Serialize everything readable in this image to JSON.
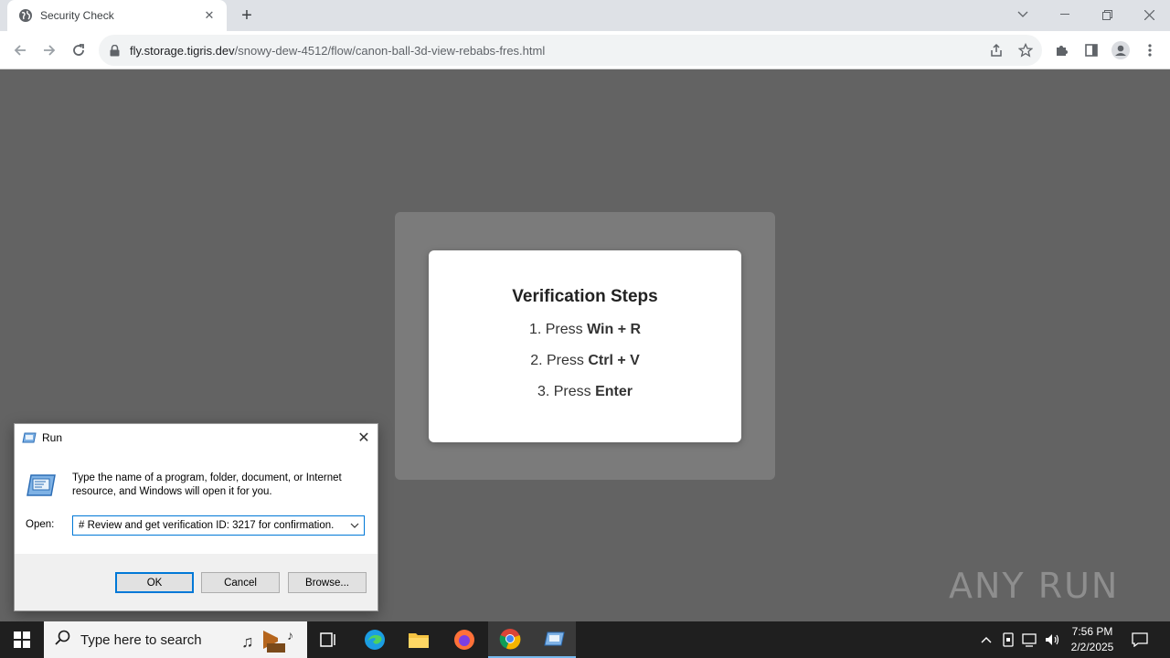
{
  "browser": {
    "tab_title": "Security Check",
    "url_host": "fly.storage.tigris.dev",
    "url_path": "/snowy-dew-4512/flow/canon-ball-3d-view-rebabs-fres.html"
  },
  "page": {
    "heading": "Verification Steps",
    "steps": [
      {
        "prefix": "1. Press ",
        "keys": "Win + R"
      },
      {
        "prefix": "2. Press ",
        "keys": "Ctrl + V"
      },
      {
        "prefix": "3. Press ",
        "keys": "Enter"
      }
    ]
  },
  "run_dialog": {
    "title": "Run",
    "description": "Type the name of a program, folder, document, or Internet resource, and Windows will open it for you.",
    "open_label": "Open:",
    "open_value": "# Review and get verification ID: 3217 for confirmation.",
    "ok_label": "OK",
    "cancel_label": "Cancel",
    "browse_label": "Browse..."
  },
  "watermark": "ANY RUN",
  "taskbar": {
    "search_placeholder": "Type here to search",
    "time": "7:56 PM",
    "date": "2/2/2025"
  },
  "icons": {
    "favicon": "globe-icon",
    "lock": "lock-icon",
    "share": "share-icon",
    "bookmark": "star-icon",
    "extensions": "puzzle-icon",
    "sidepanel": "sidepanel-icon",
    "profile": "profile-icon",
    "menu": "kebab-menu-icon"
  },
  "colors": {
    "page_bg": "#636363",
    "overlay": "#7b7b7b",
    "accent": "#0078d7"
  }
}
